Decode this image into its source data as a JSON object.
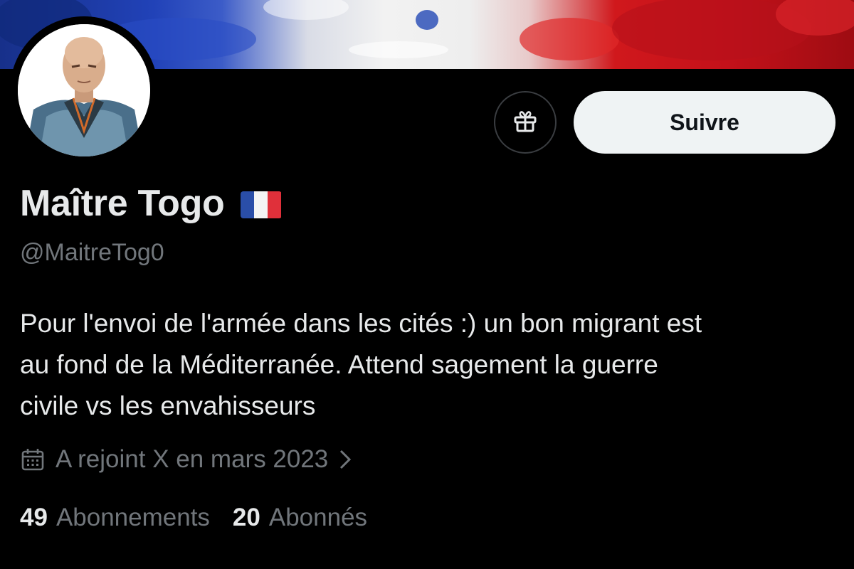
{
  "profile": {
    "display_name": "Maître Togo",
    "handle": "@MaitreTog0",
    "bio_lines": [
      "Pour l'envoi de l'armée dans les cités :) un bon migrant est",
      "au fond de la Méditerranée. Attend sagement la guerre",
      "civile vs les envahisseurs"
    ],
    "joined": "A rejoint X en mars 2023",
    "following_count": "49",
    "following_label": "Abonnements",
    "followers_count": "20",
    "followers_label": "Abonnés"
  },
  "actions": {
    "follow_label": "Suivre",
    "gift_icon": "gift-icon"
  },
  "colors": {
    "background": "#000000",
    "text_primary": "#e7e9ea",
    "text_secondary": "#71767b",
    "follow_button_bg": "#eff3f4",
    "flag_blue": "#2a4ea8",
    "flag_white": "#f4f4f4",
    "flag_red": "#e0303a"
  }
}
